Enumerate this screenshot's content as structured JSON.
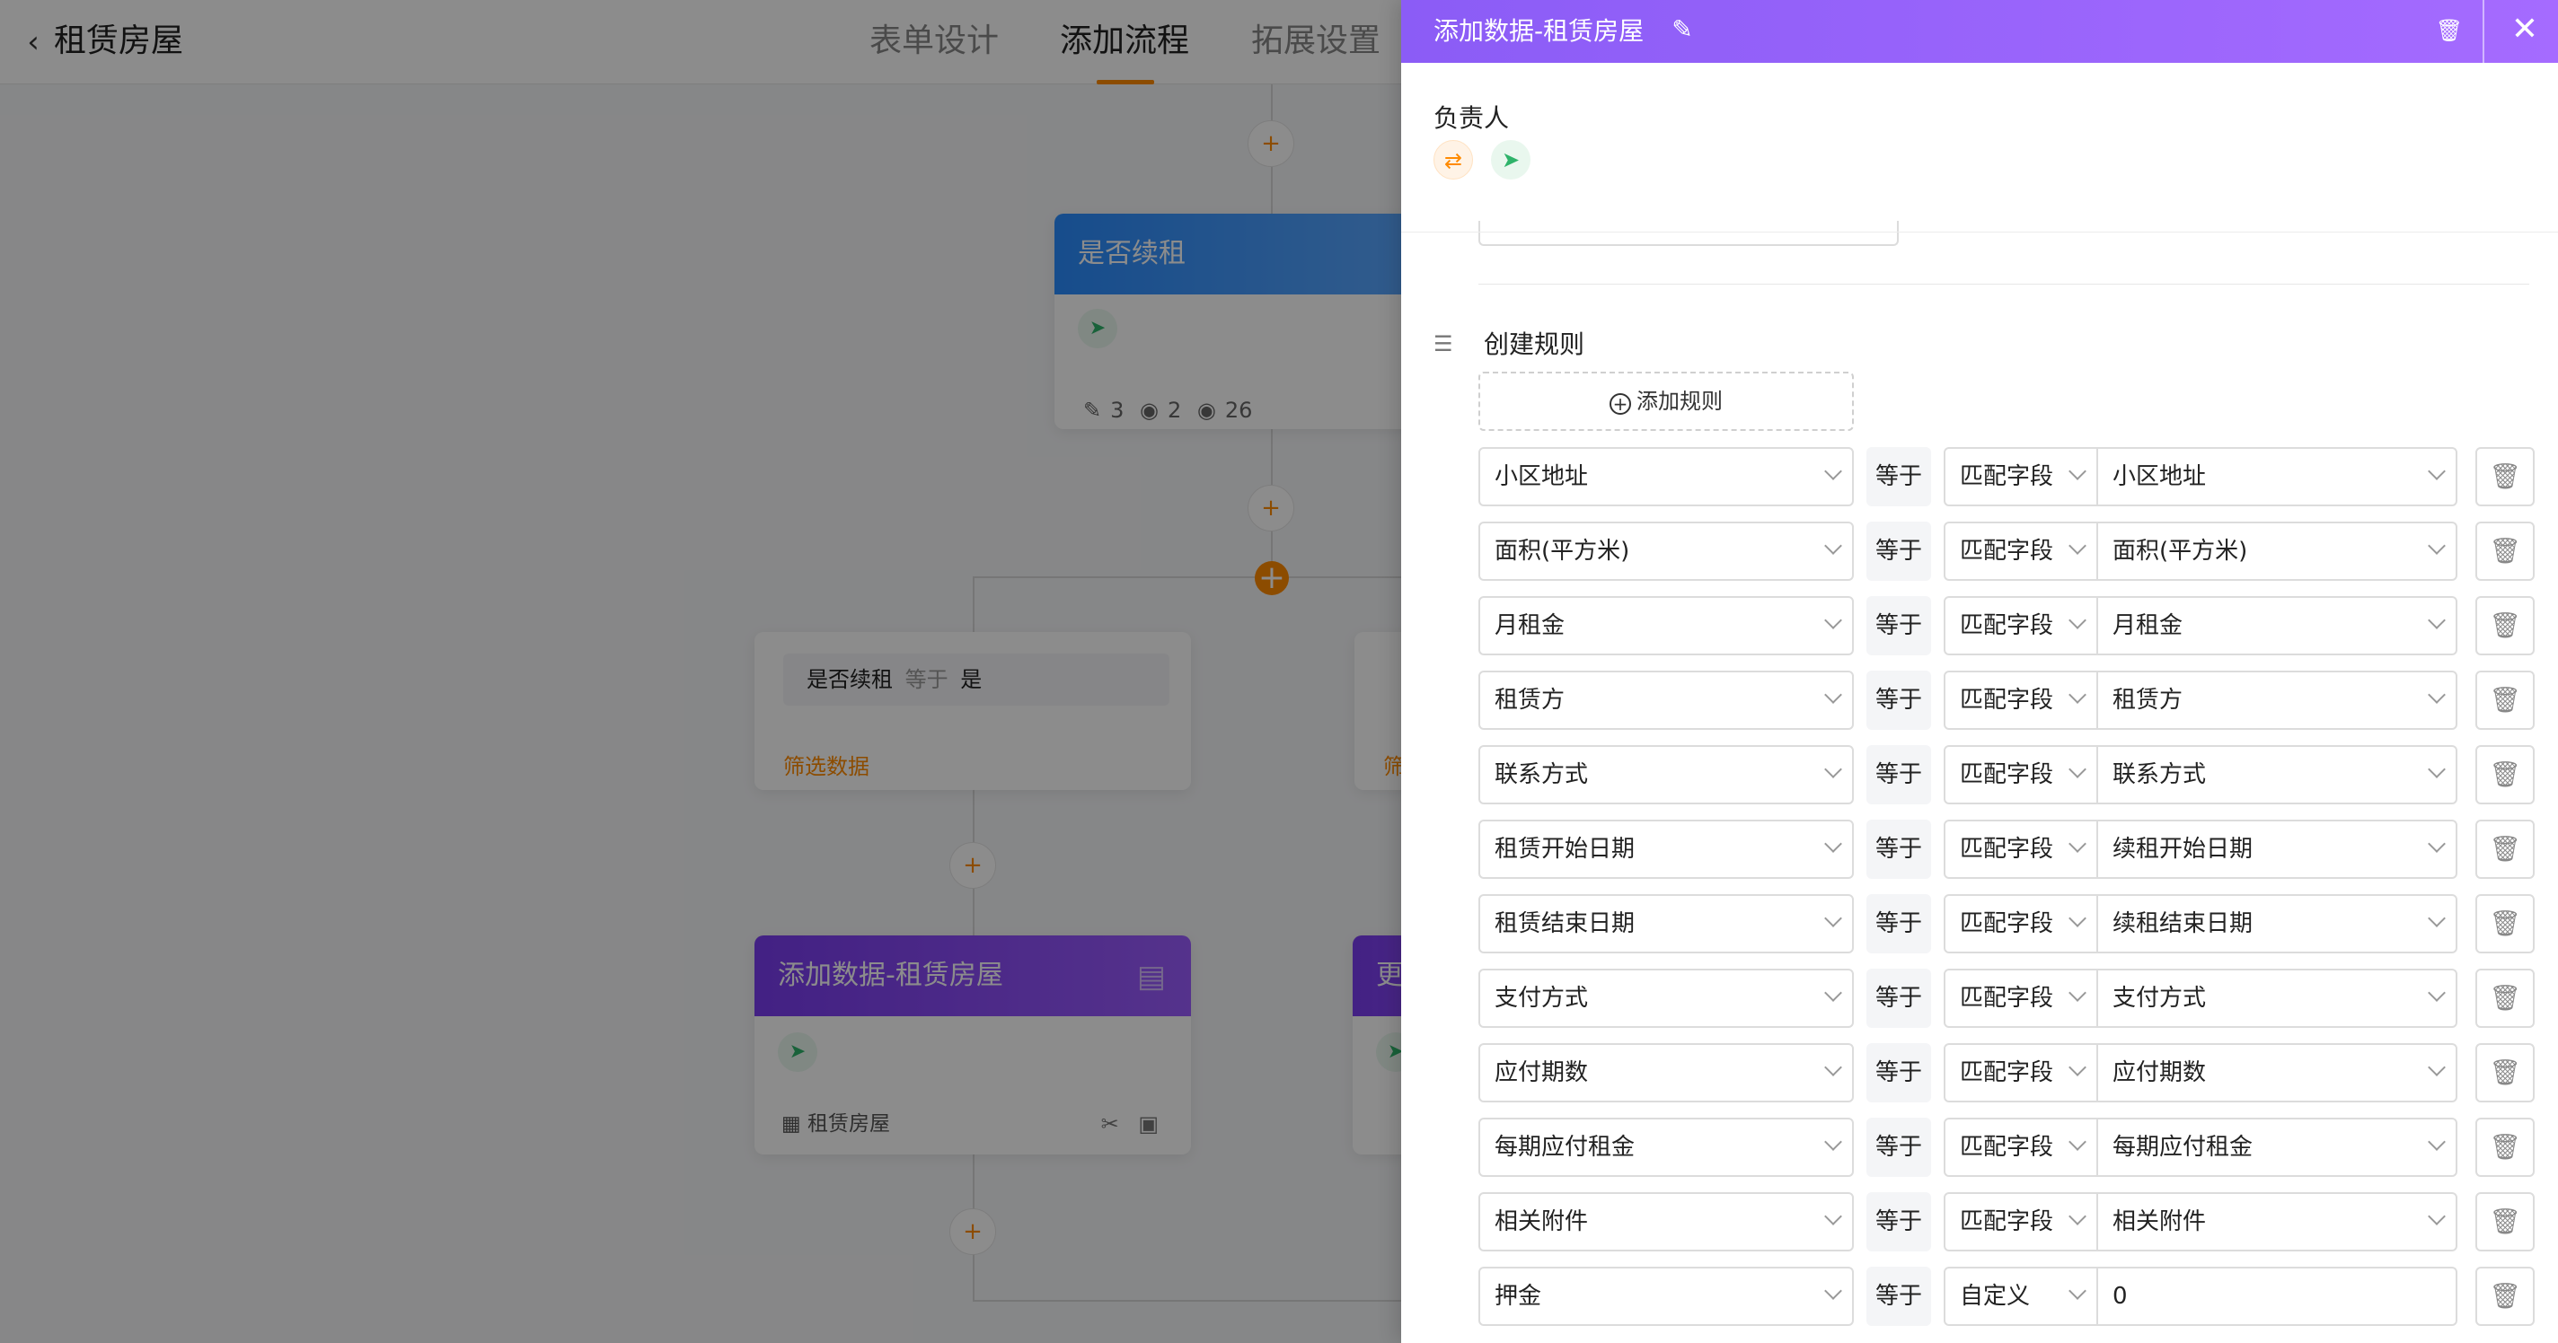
{
  "app": {
    "back_icon": "chevron-left-icon",
    "title": "租赁房屋",
    "tabs": [
      {
        "label": "表单设计",
        "active": false
      },
      {
        "label": "添加流程",
        "active": true
      },
      {
        "label": "拓展设置",
        "active": false
      }
    ]
  },
  "flow": {
    "renew_node": {
      "title": "是否续租",
      "stats": {
        "edit": "3",
        "view1": "2",
        "view2": "26"
      }
    },
    "condition_card": {
      "field": "是否续租",
      "op": "等于",
      "value": "是",
      "link": "筛选数据",
      "partial_link": "筛"
    },
    "add_node": {
      "title": "添加数据-租赁房屋",
      "table": "租赁房屋"
    },
    "partial_node": {
      "title": "更"
    }
  },
  "drawer": {
    "title": "添加数据-租赁房屋",
    "owner_label": "负责人",
    "rules_title": "创建规则",
    "add_rule_label": "添加规则",
    "rules": [
      {
        "field": "小区地址",
        "op": "等于",
        "mode": "匹配字段",
        "value": "小区地址"
      },
      {
        "field": "面积(平方米)",
        "op": "等于",
        "mode": "匹配字段",
        "value": "面积(平方米)"
      },
      {
        "field": "月租金",
        "op": "等于",
        "mode": "匹配字段",
        "value": "月租金"
      },
      {
        "field": "租赁方",
        "op": "等于",
        "mode": "匹配字段",
        "value": "租赁方"
      },
      {
        "field": "联系方式",
        "op": "等于",
        "mode": "匹配字段",
        "value": "联系方式"
      },
      {
        "field": "租赁开始日期",
        "op": "等于",
        "mode": "匹配字段",
        "value": "续租开始日期"
      },
      {
        "field": "租赁结束日期",
        "op": "等于",
        "mode": "匹配字段",
        "value": "续租结束日期"
      },
      {
        "field": "支付方式",
        "op": "等于",
        "mode": "匹配字段",
        "value": "支付方式"
      },
      {
        "field": "应付期数",
        "op": "等于",
        "mode": "匹配字段",
        "value": "应付期数"
      },
      {
        "field": "每期应付租金",
        "op": "等于",
        "mode": "匹配字段",
        "value": "每期应付租金"
      },
      {
        "field": "相关附件",
        "op": "等于",
        "mode": "匹配字段",
        "value": "相关附件"
      },
      {
        "field": "押金",
        "op": "等于",
        "mode": "自定义",
        "value": "0"
      }
    ]
  },
  "colors": {
    "accent": "#ff8a00",
    "drawer_header": "#8b5cf6",
    "blue_node": "#2a8cff",
    "purple_node": "#7a3cf0",
    "send_green": "#2eb36a"
  }
}
